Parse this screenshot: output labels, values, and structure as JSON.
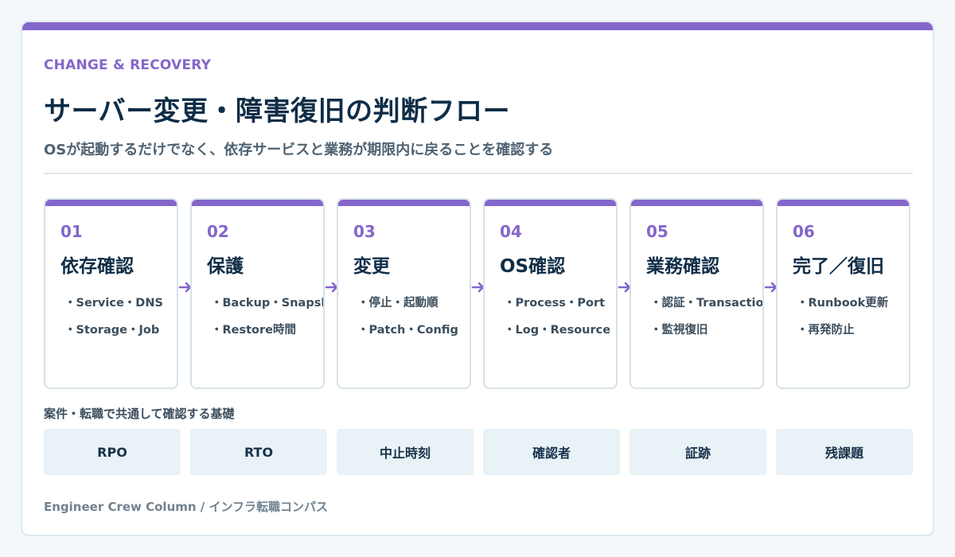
{
  "header": {
    "eyebrow": "CHANGE & RECOVERY",
    "title": "サーバー変更・障害復旧の判断フロー",
    "subtitle": "OSが起動するだけでなく、依存サービスと業務が期限内に戻ることを確認する"
  },
  "colors": {
    "accent": "#8466cc",
    "title": "#0f2d47",
    "chip_bg": "#e9f2f6",
    "card_border": "#d7e1e8"
  },
  "steps": [
    {
      "num": "01",
      "title": "依存確認",
      "items": [
        "Service・DNS",
        "Storage・Job"
      ]
    },
    {
      "num": "02",
      "title": "保護",
      "items": [
        "Backup・Snapshot",
        "Restore時間"
      ]
    },
    {
      "num": "03",
      "title": "変更",
      "items": [
        "停止・起動順",
        "Patch・Config"
      ]
    },
    {
      "num": "04",
      "title": "OS確認",
      "items": [
        "Process・Port",
        "Log・Resource"
      ]
    },
    {
      "num": "05",
      "title": "業務確認",
      "items": [
        "認証・Transaction",
        "監視復旧"
      ]
    },
    {
      "num": "06",
      "title": "完了／復旧",
      "items": [
        "Runbook更新",
        "再発防止"
      ]
    }
  ],
  "arrow_icon": "arrow-right-icon",
  "basics": {
    "label": "案件・転職で共通して確認する基礎",
    "chips": [
      "RPO",
      "RTO",
      "中止時刻",
      "確認者",
      "証跡",
      "残課題"
    ]
  },
  "footer": "Engineer Crew Column / インフラ転職コンパス"
}
